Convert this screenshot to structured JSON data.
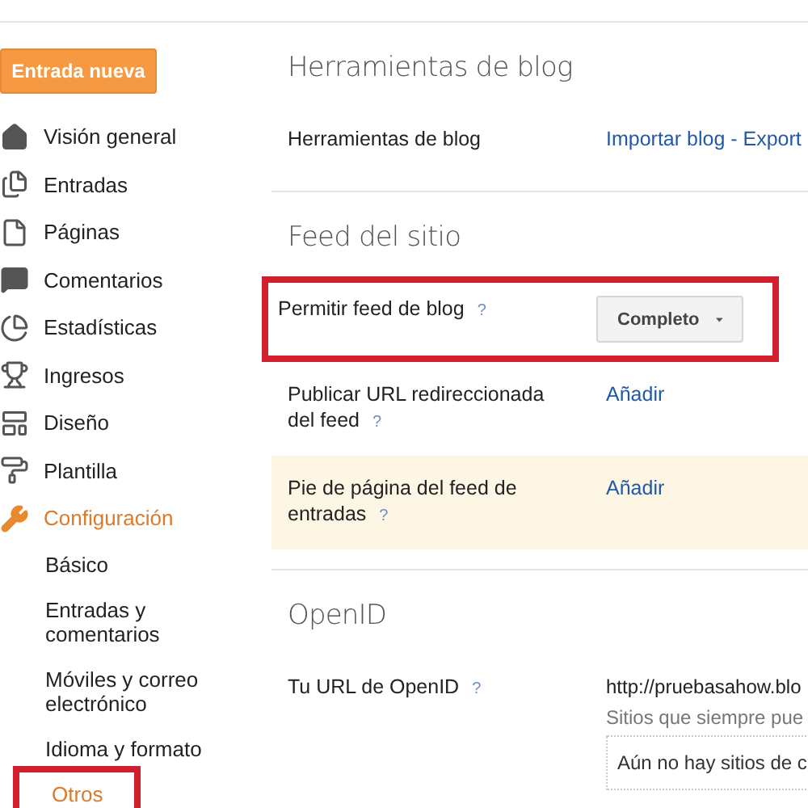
{
  "new_post_button": "Entrada nueva",
  "nav": [
    {
      "label": "Visión general",
      "selected": false
    },
    {
      "label": "Entradas",
      "selected": false
    },
    {
      "label": "Páginas",
      "selected": false
    },
    {
      "label": "Comentarios",
      "selected": false
    },
    {
      "label": "Estadísticas",
      "selected": false
    },
    {
      "label": "Ingresos",
      "selected": false
    },
    {
      "label": "Diseño",
      "selected": false
    },
    {
      "label": "Plantilla",
      "selected": false
    },
    {
      "label": "Configuración",
      "selected": true,
      "children": [
        {
          "label": "Básico",
          "selected": false,
          "annotated": false
        },
        {
          "label": "Entradas y comentarios",
          "selected": false,
          "annotated": false
        },
        {
          "label": "Móviles y correo electrónico",
          "selected": false,
          "annotated": false
        },
        {
          "label": "Idioma y formato",
          "selected": false,
          "annotated": false
        },
        {
          "label": "Otros",
          "selected": true,
          "annotated": true
        }
      ]
    }
  ],
  "sections": [
    {
      "title": "Herramientas de blog",
      "rows": [
        {
          "label": "Herramientas de blog",
          "kind": "link",
          "value": "Importar blog - Export",
          "highlighted": false,
          "annotated": false
        }
      ]
    },
    {
      "title": "Feed del sitio",
      "rows": [
        {
          "label": "Permitir feed de blog",
          "help": "?",
          "kind": "dropdown",
          "value": "Completo",
          "highlighted": false,
          "annotated": true
        },
        {
          "label": "Publicar URL redireccionada del feed",
          "help": "?",
          "kind": "link",
          "value": "Añadir",
          "highlighted": false,
          "annotated": false
        },
        {
          "label": "Pie de página del feed de entradas",
          "help": "?",
          "kind": "link",
          "value": "Añadir",
          "highlighted": true,
          "annotated": false
        }
      ]
    },
    {
      "title": "OpenID",
      "rows": [
        {
          "label": "Tu URL de OpenID",
          "help": "?",
          "kind": "openid",
          "value": "http://pruebasahow.blo",
          "note": "Sitios que siempre pue",
          "empty_list": "Aún no hay sitios de c",
          "highlighted": false,
          "annotated": false
        }
      ]
    }
  ]
}
